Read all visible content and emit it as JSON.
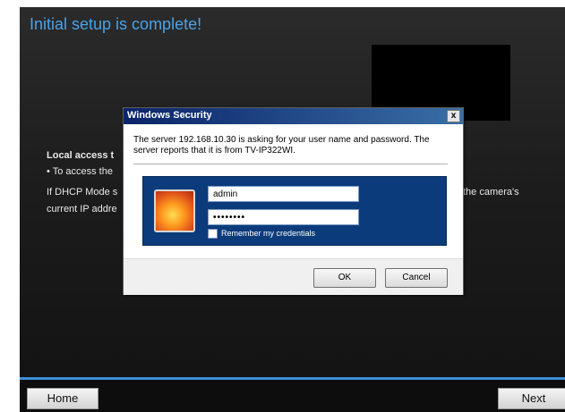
{
  "page": {
    "title": "Initial setup is complete!",
    "local_access_heading": "Local access t",
    "bullet_line": "• To access the",
    "dhcp_line": "If DHCP Mode s",
    "dhcp_line_right": "the camera's",
    "ip_line": "current IP addre"
  },
  "nav": {
    "home_label": "Home",
    "next_label": "Next"
  },
  "dialog": {
    "title": "Windows Security",
    "close_glyph": "x",
    "message": "The server 192.168.10.30 is asking for your user name and password. The server reports that it is from TV-IP322WI.",
    "username_value": "admin",
    "password_value": "••••••••",
    "remember_label": "Remember my credentials",
    "ok_label": "OK",
    "cancel_label": "Cancel"
  },
  "colors": {
    "title_blue": "#4aa2e6",
    "accent_bar": "#3a8fd6",
    "credential_panel": "#0b3b7a"
  },
  "icons": {
    "avatar": "user-avatar-flower-icon",
    "close": "close-icon"
  }
}
